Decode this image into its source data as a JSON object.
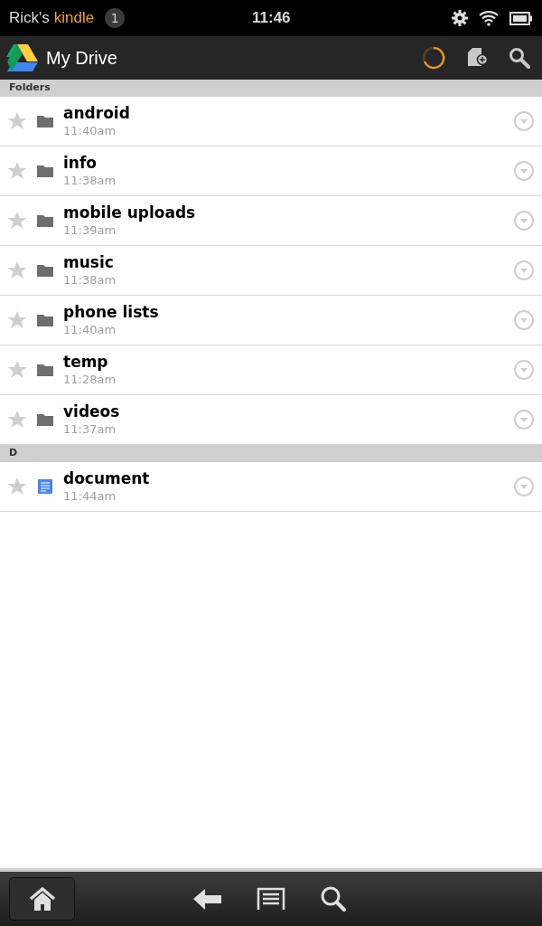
{
  "status_bar": {
    "owner": "Rick's",
    "device": "kindle",
    "notifications": "1",
    "time": "11:46"
  },
  "toolbar": {
    "title": "My Drive"
  },
  "sections": [
    {
      "header": "Folders",
      "items": [
        {
          "kind": "folder",
          "name": "android",
          "time": "11:40am",
          "starred": false
        },
        {
          "kind": "folder",
          "name": "info",
          "time": "11:38am",
          "starred": false
        },
        {
          "kind": "folder",
          "name": "mobile uploads",
          "time": "11:39am",
          "starred": false
        },
        {
          "kind": "folder",
          "name": "music",
          "time": "11:38am",
          "starred": false
        },
        {
          "kind": "folder",
          "name": "phone lists",
          "time": "11:40am",
          "starred": false
        },
        {
          "kind": "folder",
          "name": "temp",
          "time": "11:28am",
          "starred": false
        },
        {
          "kind": "folder",
          "name": "videos",
          "time": "11:37am",
          "starred": false
        }
      ]
    },
    {
      "header": "D",
      "items": [
        {
          "kind": "document",
          "name": "document",
          "time": "11:44am",
          "starred": false
        }
      ]
    }
  ]
}
